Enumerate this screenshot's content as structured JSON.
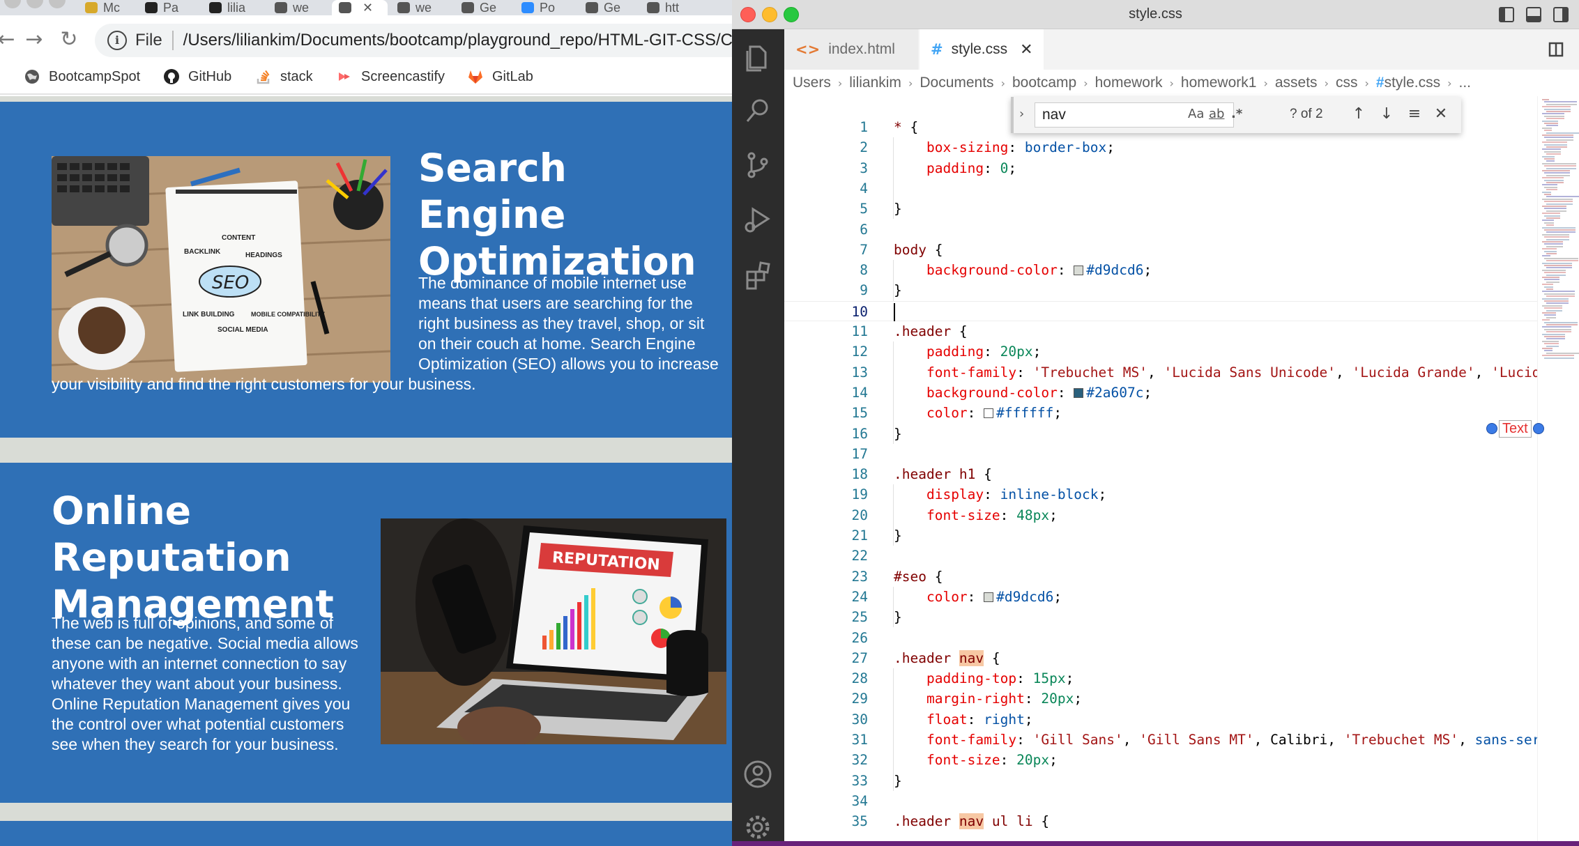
{
  "browser": {
    "tabs": [
      {
        "title": "Mc",
        "color": "#d7a92b"
      },
      {
        "title": "Pa",
        "color": "#222222"
      },
      {
        "title": "lilia",
        "color": "#222222"
      },
      {
        "title": "we",
        "color": "#555555"
      },
      {
        "title": "",
        "color": "#555555"
      },
      {
        "title": "we",
        "color": "#555555"
      },
      {
        "title": "Ge",
        "color": "#555555"
      },
      {
        "title": "Po",
        "color": "#2d8cff"
      },
      {
        "title": "Ge",
        "color": "#555555"
      },
      {
        "title": "htt",
        "color": "#555555"
      }
    ],
    "address": {
      "file_label": "File",
      "url": "/Users/liliankim/Documents/bootcamp/playground_repo/HTML-GIT-CSS/C"
    },
    "bookmarks": [
      "BootcampSpot",
      "GitHub",
      "stack",
      "Screencastify",
      "GitLab"
    ],
    "page": {
      "seo_title": "Search Engine Optimization",
      "seo_text": "The dominance of mobile internet use means that users are searching for the right business as they travel, shop, or sit on their couch at home. Search Engine Optimization (SEO) allows you to increase your visibility and find the right customers for your business.",
      "orm_title": "Online Reputation Management",
      "orm_text": "The web is full of opinions, and some of these can be negative. Social media allows anyone with an internet connection to say whatever they want about your business. Online Reputation Management gives you the control over what potential customers see when they search for your business.",
      "seo_image_words": [
        "CONTENT",
        "BACKLINK",
        "HEADINGS",
        "SEO",
        "LINK BUILDING",
        "MOBILE COMPATIBILITY",
        "SOCIAL MEDIA"
      ],
      "orm_image_word": "REPUTATION"
    }
  },
  "vscode": {
    "window_title": "style.css",
    "tabs": [
      {
        "label": "index.html",
        "icon": "<>",
        "active": false
      },
      {
        "label": "style.css",
        "icon": "#",
        "active": true
      }
    ],
    "breadcrumb": [
      "Users",
      "liliankim",
      "Documents",
      "bootcamp",
      "homework",
      "homework1",
      "assets",
      "css",
      "style.css",
      "..."
    ],
    "find": {
      "query": "nav",
      "match_case": "Aa",
      "whole_word": "ab",
      "regex": ".*",
      "count": "? of 2"
    },
    "text_handle_label": "Text",
    "current_line": 10,
    "lines": [
      "* {",
      "    box-sizing: border-box;",
      "    padding: 0;",
      "",
      "}",
      "",
      "body {",
      "    background-color: #d9dcd6;",
      "}",
      "",
      ".header {",
      "    padding: 20px;",
      "    font-family: 'Trebuchet MS', 'Lucida Sans Unicode', 'Lucida Grande', 'Lucid",
      "    background-color: #2a607c;",
      "    color: #ffffff;",
      "}",
      "",
      ".header h1 {",
      "    display: inline-block;",
      "    font-size: 48px;",
      "}",
      "",
      "#seo {",
      "    color: #d9dcd6;",
      "}",
      "",
      ".header nav {",
      "    padding-top: 15px;",
      "    margin-right: 20px;",
      "    float: right;",
      "    font-family: 'Gill Sans', 'Gill Sans MT', Calibri, 'Trebuchet MS', sans-ser",
      "    font-size: 20px;",
      "}",
      "",
      ".header nav ul li {"
    ],
    "colors": {
      "accent": "#2f70b6",
      "activity_bar": "#2c2c2c",
      "status_bar": "#68217a"
    }
  }
}
